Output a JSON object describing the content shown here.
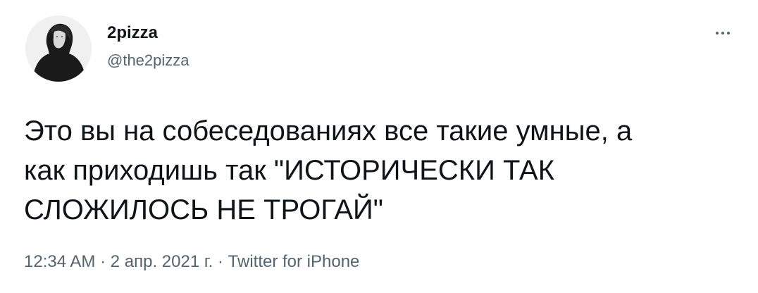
{
  "author": {
    "display_name": "2pizza",
    "handle": "@the2pizza",
    "avatar_icon": "user-avatar-hooded-figure"
  },
  "more_icon": "more-horizontal-icon",
  "tweet": {
    "text_lines": [
      "Это вы на собеседованиях все такие умные, а",
      "как приходишь так \"ИСТОРИЧЕСКИ ТАК",
      "СЛОЖИЛОСЬ НЕ ТРОГАЙ\""
    ]
  },
  "meta": {
    "time": "12:34 AM",
    "separator": " · ",
    "date": "2 апр. 2021 г.",
    "source": "Twitter for iPhone"
  },
  "colors": {
    "text_primary": "#0f1419",
    "text_secondary": "#536471",
    "background": "#ffffff"
  }
}
